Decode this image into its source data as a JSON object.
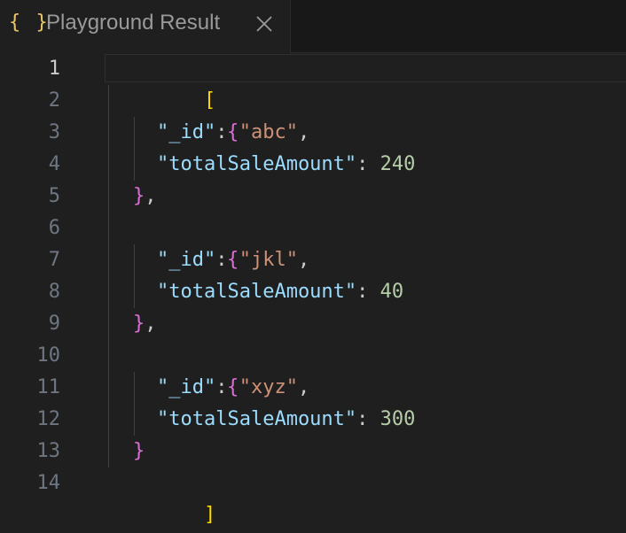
{
  "tab": {
    "icon_text": "{ }",
    "title": "Playground Result",
    "icon_color": "#e9c46a"
  },
  "editor": {
    "line_numbers": [
      "1",
      "2",
      "3",
      "4",
      "5",
      "6",
      "7",
      "8",
      "9",
      "10",
      "11",
      "12",
      "13",
      "14"
    ],
    "active_line": "1",
    "open_array": "[",
    "close_array": "]",
    "open_obj": "{",
    "close_obj": "}",
    "comma": ",",
    "colon": ": ",
    "records": [
      {
        "id_key": "\"_id\"",
        "id_value": "\"abc\"",
        "amount_key": "\"totalSaleAmount\"",
        "amount_value": "240"
      },
      {
        "id_key": "\"_id\"",
        "id_value": "\"jkl\"",
        "amount_key": "\"totalSaleAmount\"",
        "amount_value": "40"
      },
      {
        "id_key": "\"_id\"",
        "id_value": "\"xyz\"",
        "amount_key": "\"totalSaleAmount\"",
        "amount_value": "300"
      }
    ]
  },
  "colors": {
    "background": "#1f1f1f",
    "key": "#9cdcfe",
    "string": "#ce9178",
    "number": "#b5cea8",
    "bracket_outer": "#ffd700",
    "bracket_inner": "#da70d6"
  }
}
